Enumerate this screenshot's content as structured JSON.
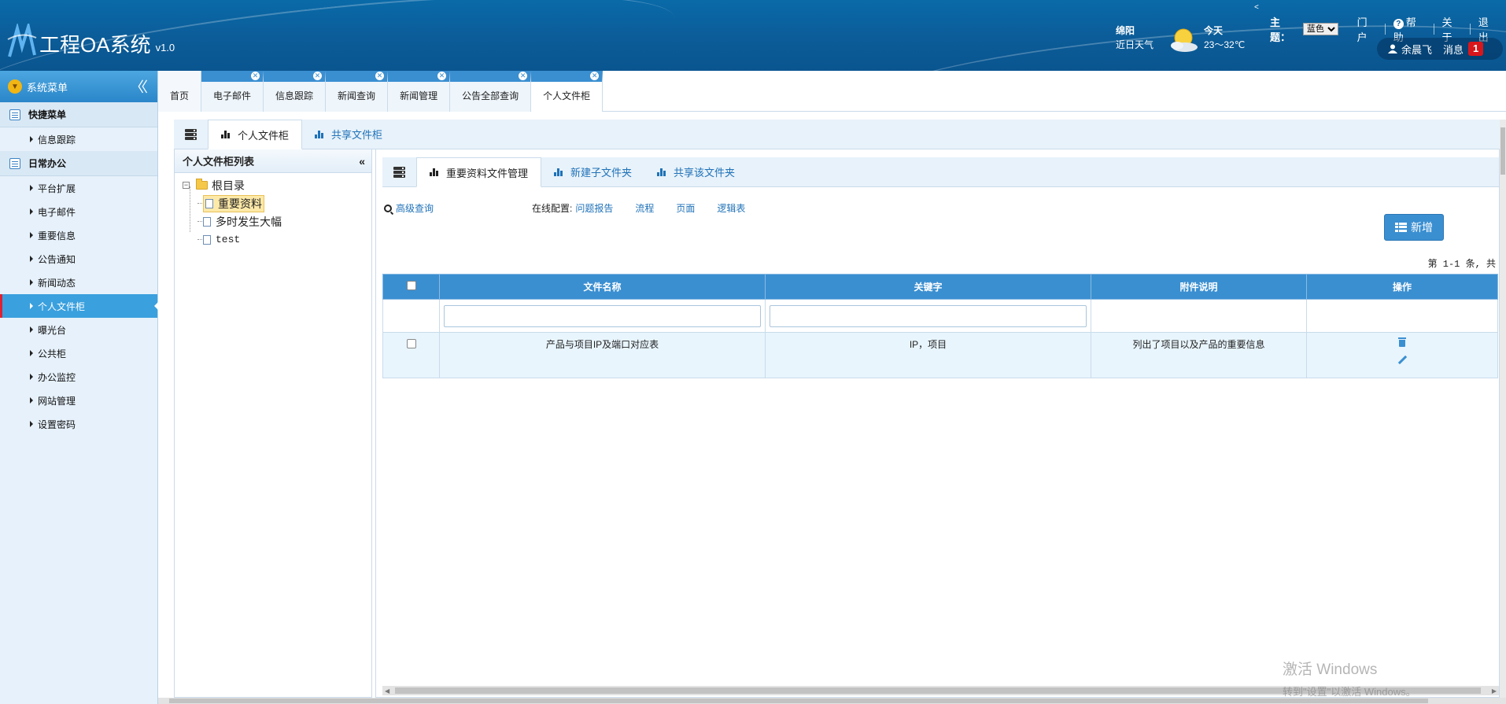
{
  "app": {
    "title": "工程OA系统",
    "version": "v1.0"
  },
  "weather": {
    "city": "绵阳",
    "label": "近日天气",
    "day": "今天",
    "temp": "23～32℃"
  },
  "topnav": {
    "theme_label": "主题：",
    "theme_value": "蓝色",
    "portal": "门户",
    "help": "帮助",
    "about": "关于",
    "logout": "退出"
  },
  "user": {
    "name": "余晨飞",
    "msg_label": "消息",
    "msg_count": "1"
  },
  "sidebar": {
    "title": "系统菜单",
    "quick_group": "快捷菜单",
    "quick_items": [
      "信息跟踪"
    ],
    "office_group": "日常办公",
    "office_items": [
      "平台扩展",
      "电子邮件",
      "重要信息",
      "公告通知",
      "新闻动态",
      "个人文件柜",
      "曝光台",
      "公共柜",
      "办公监控",
      "网站管理",
      "设置密码"
    ]
  },
  "tabs": [
    "首页",
    "电子邮件",
    "信息跟踪",
    "新闻查询",
    "新闻管理",
    "公告全部查询",
    "个人文件柜"
  ],
  "subtabs": [
    "个人文件柜",
    "共享文件柜"
  ],
  "tree": {
    "title": "个人文件柜列表",
    "root": "根目录",
    "children": [
      "重要资料",
      "多时发生大幅",
      "test"
    ]
  },
  "content": {
    "subtabs": [
      "重要资料文件管理",
      "新建子文件夹",
      "共享该文件夹"
    ],
    "advanced_query": "高级查询",
    "online_config_label": "在线配置:",
    "online_config_links": [
      "问题报告",
      "流程",
      "页面",
      "逻辑表"
    ],
    "new_button": "新增",
    "pager": "第 1-1 条, 共",
    "columns": [
      "文件名称",
      "关键字",
      "附件说明",
      "操作"
    ],
    "rows": [
      {
        "name": "产品与项目IP及端口对应表",
        "keywords": "IP，项目",
        "desc": "列出了项目以及产品的重要信息"
      }
    ]
  },
  "watermark": {
    "line1": "激活 Windows",
    "line2": "转到\"设置\"以激活 Windows。"
  },
  "colors": {
    "header": "#0b5c98",
    "accent": "#3a8fd1",
    "active_nav": "#3aa0de",
    "badge": "#d9161b"
  }
}
